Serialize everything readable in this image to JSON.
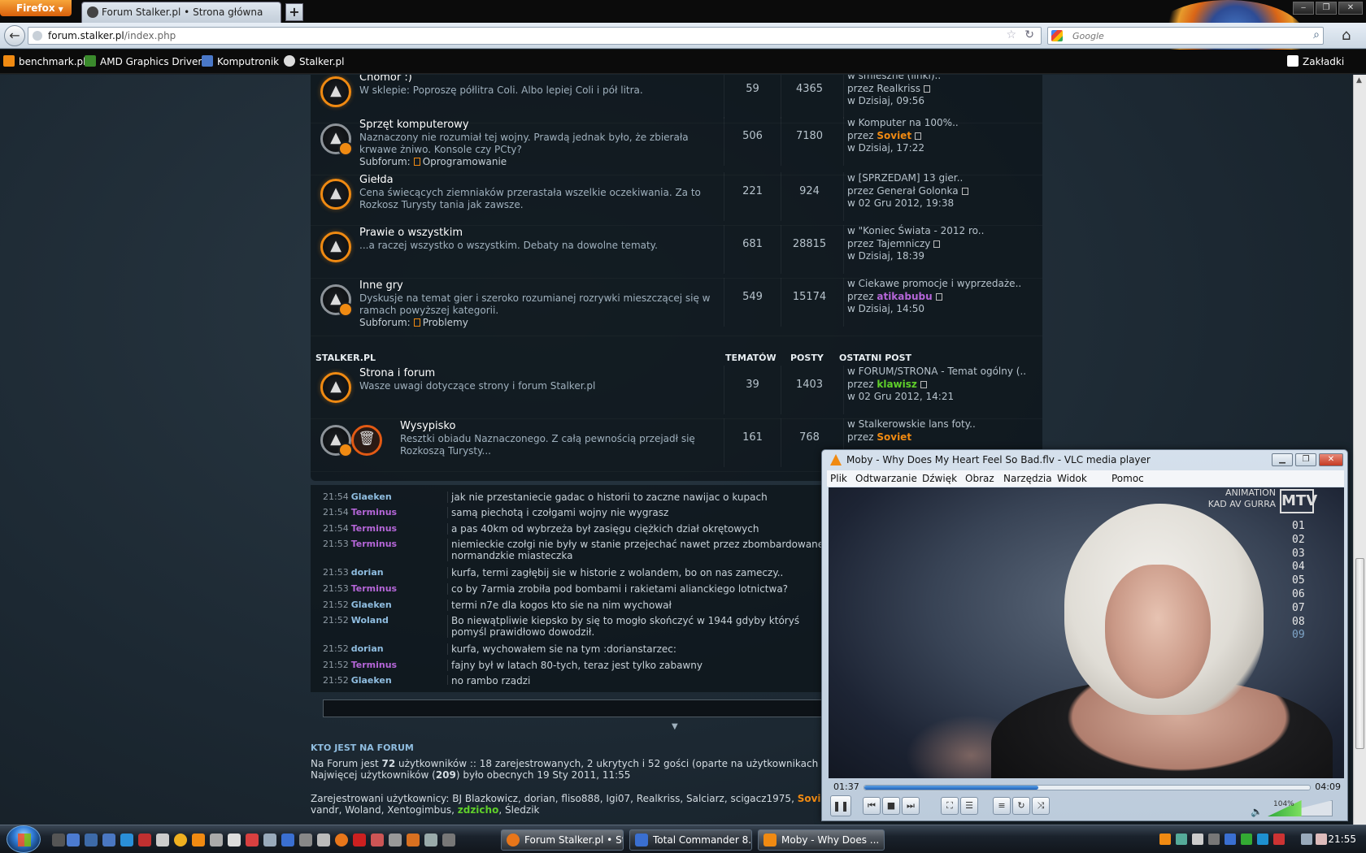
{
  "browser": {
    "app_button": "Firefox",
    "tab_title": "Forum Stalker.pl • Strona główna",
    "url_host": "forum.stalker.pl",
    "url_path": "/index.php",
    "search_placeholder": "Google",
    "bookmarks": [
      {
        "label": "benchmark.pl",
        "color": "#f08a12"
      },
      {
        "label": "AMD Graphics Drivers",
        "color": "#3a8a2c"
      },
      {
        "label": "Komputronik",
        "color": "#4a78c8"
      },
      {
        "label": "Stalker.pl",
        "color": "#dcdcdc"
      }
    ],
    "bookmarks_menu": "Zakładki"
  },
  "forums": [
    {
      "title": "Chomor :)",
      "description": "W sklepie: Poproszę półlitra Coli. Albo lepiej Coli i pół litra.",
      "subforum_label": "",
      "subforum_name": "",
      "topics": "59",
      "posts": "4365",
      "last_post": {
        "topic": "w śmieszne (linki)..",
        "by": "przez",
        "user": "Realkriss",
        "user_style": "plain",
        "date": "w Dzisiaj, 09:56"
      },
      "icon": "orange"
    },
    {
      "title": "Sprzęt komputerowy",
      "description": "Naznaczony nie rozumiał tej wojny. Prawdą jednak było, że zbierała krwawe żniwo. Konsole czy PCty?",
      "subforum_label": "Subforum:",
      "subforum_name": "Oprogramowanie",
      "topics": "506",
      "posts": "7180",
      "last_post": {
        "topic": "w Komputer na 100%..",
        "by": "przez",
        "user": "Soviet",
        "user_style": "orange",
        "date": "w Dzisiaj, 17:22"
      },
      "icon": "gray"
    },
    {
      "title": "Giełda",
      "description": "Cena świecących ziemniaków przerastała wszelkie oczekiwania. Za to Rozkosz Turysty tania jak zawsze.",
      "subforum_label": "",
      "subforum_name": "",
      "topics": "221",
      "posts": "924",
      "last_post": {
        "topic": "w [SPRZEDAM] 13 gier..",
        "by": "przez",
        "user": "Generał Golonka",
        "user_style": "plain",
        "date": "w 02 Gru 2012, 19:38"
      },
      "icon": "orange"
    },
    {
      "title": "Prawie o wszystkim",
      "description": "...a raczej wszystko o wszystkim. Debaty na dowolne tematy.",
      "subforum_label": "",
      "subforum_name": "",
      "topics": "681",
      "posts": "28815",
      "last_post": {
        "topic": "w \"Koniec Świata - 2012 ro..",
        "by": "przez",
        "user": "Tajemniczy",
        "user_style": "plain",
        "date": "w Dzisiaj, 18:39"
      },
      "icon": "orange"
    },
    {
      "title": "Inne gry",
      "description": "Dyskusje na temat gier i szeroko rozumianej rozrywki mieszczącej się w ramach powyższej kategorii.",
      "subforum_label": "Subforum:",
      "subforum_name": "Problemy",
      "topics": "549",
      "posts": "15174",
      "last_post": {
        "topic": "w Ciekawe promocje i wyprzedaże..",
        "by": "przez",
        "user": "atikabubu",
        "user_style": "purple",
        "date": "w Dzisiaj, 14:50"
      },
      "icon": "gray"
    }
  ],
  "section": {
    "name": "STALKER.PL",
    "col_topics": "TEMATÓW",
    "col_posts": "POSTY",
    "col_last": "OSTATNI POST"
  },
  "forums2": [
    {
      "title": "Strona i forum",
      "description": "Wasze uwagi dotyczące strony i forum Stalker.pl",
      "topics": "39",
      "posts": "1403",
      "last_post": {
        "topic": "w FORUM/STRONA - Temat ogólny (..",
        "by": "przez",
        "user": "klawisz",
        "user_style": "green",
        "date": "w 02 Gru 2012, 14:21"
      }
    },
    {
      "title": "Wysypisko",
      "description": "Resztki obiadu Naznaczonego. Z całą pewnością przejadł się Rozkoszą Turysty...",
      "topics": "161",
      "posts": "768",
      "last_post": {
        "topic": "w Stalkerowskie lans foty..",
        "by": "przez",
        "user": "Soviet",
        "user_style": "orange",
        "date": ""
      }
    }
  ],
  "shoutbox": [
    {
      "time": "21:54",
      "nick": "Glaeken",
      "color": "blue",
      "msg": "jak nie przestaniecie gadac o historii to zaczne nawijac o kupach"
    },
    {
      "time": "21:54",
      "nick": "Terminus",
      "color": "purple",
      "msg": "samą piechotą i czołgami wojny nie wygrasz"
    },
    {
      "time": "21:54",
      "nick": "Terminus",
      "color": "purple",
      "msg": "a pas 40km od wybrzeża był zasięgu ciężkich dział okrętowych"
    },
    {
      "time": "21:53",
      "nick": "Terminus",
      "color": "purple",
      "msg": "niemieckie czołgi nie były w stanie przejechać nawet przez zbombardowane normandzkie miasteczka"
    },
    {
      "time": "21:53",
      "nick": "dorian",
      "color": "blue",
      "msg": "kurfa, termi zagłębij sie w historie z wolandem, bo on nas zameczy.."
    },
    {
      "time": "21:53",
      "nick": "Terminus",
      "color": "purple",
      "msg": "co by 7armia zrobiła pod bombami i rakietami alianckiego lotnictwa?"
    },
    {
      "time": "21:52",
      "nick": "Glaeken",
      "color": "blue",
      "msg": "termi n7e dla kogos kto sie na nim wychował"
    },
    {
      "time": "21:52",
      "nick": "Woland",
      "color": "blue",
      "msg": "Bo niewątpliwie kiepsko by się to mogło skończyć w 1944 gdyby któryś pomyśl prawidłowo dowodził."
    },
    {
      "time": "21:52",
      "nick": "dorian",
      "color": "blue",
      "msg": "kurfa, wychowałem sie na tym :dorianstarzec:"
    },
    {
      "time": "21:52",
      "nick": "Terminus",
      "color": "purple",
      "msg": "fajny był w latach 80-tych, teraz jest tylko zabawny"
    },
    {
      "time": "21:52",
      "nick": "Glaeken",
      "color": "blue",
      "msg": "no rambo rządzi"
    }
  ],
  "online": {
    "heading": "KTO JEST NA FORUM",
    "line1_a": "Na Forum jest ",
    "line1_count": "72",
    "line1_b": " użytkowników :: 18 zarejestrowanych, 2 ukrytych i 52 gości (oparte na użytkownikach akty",
    "line2_a": "Najwięcej użytkowników (",
    "line2_count": "209",
    "line2_b": ") było obecnych 19 Sty 2011, 11:55",
    "line3": "Zarejestrowani użytkownicy: BJ Blazkowicz, dorian, fliso888, Igi07, Realkriss, Salciarz, scigacz1975, ",
    "line3_user": "Soviet",
    "line3_end": ",",
    "line4": "vandr, Woland, Xentogimbus, ",
    "line4_user": "zdzicho",
    "line4_end": ", Śledzik"
  },
  "vlc": {
    "title": "Moby - Why Does My Heart Feel So Bad.flv - VLC media player",
    "menu": [
      "Plik",
      "Odtwarzanie",
      "Dźwięk",
      "Obraz",
      "Narzędzia",
      "Widok",
      "Pomoc"
    ],
    "osd_line1": "ANIMATION",
    "osd_line2": "KAD AV GURRA",
    "channel_logo": "MTV",
    "playlist": [
      "01",
      "02",
      "03",
      "04",
      "05",
      "06",
      "07",
      "08",
      "09"
    ],
    "time_current": "01:37",
    "time_total": "04:09",
    "progress": 0.39,
    "volume_label": "104%",
    "volume": 0.52
  },
  "taskbar": {
    "tasks": [
      {
        "label": "Forum Stalker.pl • St...",
        "color": "#e8761a"
      },
      {
        "label": "Total Commander 8....",
        "color": "#3a6fd1"
      },
      {
        "label": "Moby - Why Does ...",
        "color": "#f08a12"
      }
    ],
    "clock": "21:55",
    "colors": {
      "accent": "#f08a12"
    }
  }
}
